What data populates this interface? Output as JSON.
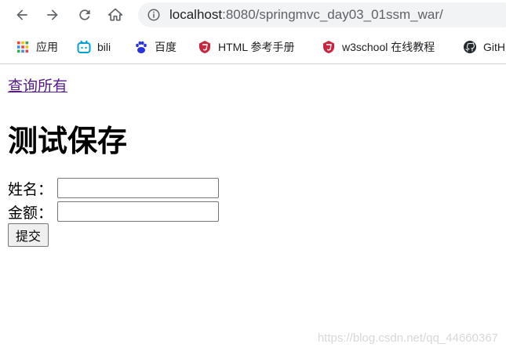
{
  "browser": {
    "url_host": "localhost",
    "url_rest": ":8080/springmvc_day03_01ssm_war/",
    "bookmarks": [
      {
        "label": "应用",
        "icon": "apps-grid-icon"
      },
      {
        "label": "bili",
        "icon": "bilibili-icon"
      },
      {
        "label": "百度",
        "icon": "baidu-paw-icon"
      },
      {
        "label": "HTML 参考手册",
        "icon": "html-shield-icon"
      },
      {
        "label": "w3school 在线教程",
        "icon": "w3school-shield-icon"
      },
      {
        "label": "GitH",
        "icon": "github-icon"
      }
    ]
  },
  "page": {
    "query_link": "查询所有",
    "title": "测试保存",
    "form": {
      "name_label": "姓名：",
      "name_value": "",
      "money_label": "金额：",
      "money_value": "",
      "submit_label": "提交"
    }
  },
  "watermark": "https://blog.csdn.net/qq_44660367",
  "colors": {
    "link_visited": "#551a8b",
    "omnibox_bg": "#f1f3f4",
    "bili_blue": "#00a1d6",
    "baidu_blue": "#2932e1",
    "shield_red": "#c7263e"
  }
}
